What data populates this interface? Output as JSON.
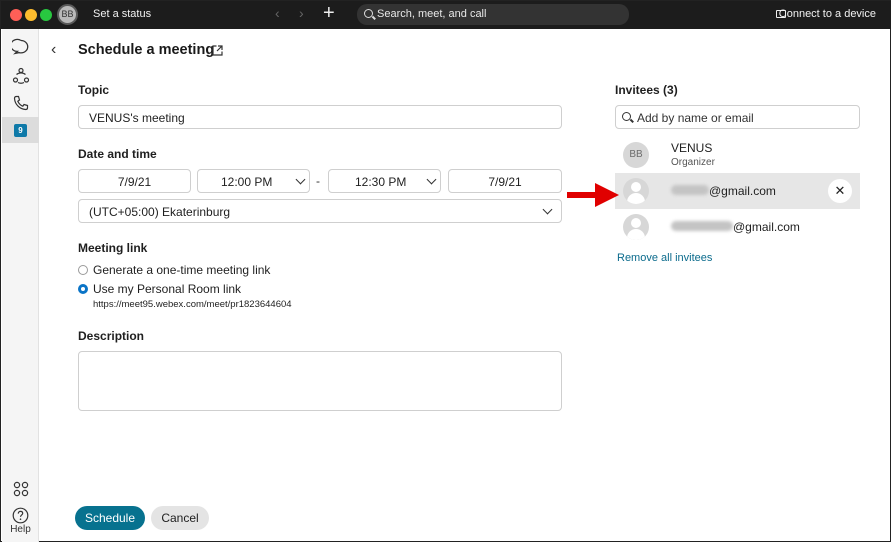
{
  "titlebar": {
    "avatar_initials": "BB",
    "status_label": "Set a status",
    "search_placeholder": "Search, meet, and call",
    "connect_label": "Connect to a device"
  },
  "rail": {
    "items": [
      {
        "icon": "chat-bubble-icon"
      },
      {
        "icon": "teams-icon"
      },
      {
        "icon": "phone-icon"
      },
      {
        "icon": "calendar-icon",
        "badge": "9"
      }
    ],
    "apps_icon": "apps-grid-icon",
    "help_label": "Help"
  },
  "page": {
    "title": "Schedule a meeting"
  },
  "form": {
    "topic_label": "Topic",
    "topic_value": "VENUS's meeting",
    "datetime_label": "Date and time",
    "start_date": "7/9/21",
    "start_time": "12:00 PM",
    "separator": "-",
    "end_time": "12:30 PM",
    "end_date": "7/9/21",
    "timezone": "(UTC+05:00) Ekaterinburg",
    "meeting_link_label": "Meeting link",
    "option_onetime": "Generate a one-time meeting link",
    "option_personal": "Use my Personal Room link",
    "selected_option": "Use my Personal Room link",
    "personal_room_url": "https://meet95.webex.com/meet/pr1823644604",
    "description_label": "Description",
    "description_value": ""
  },
  "actions": {
    "schedule_label": "Schedule",
    "cancel_label": "Cancel"
  },
  "invitees": {
    "title": "Invitees (3)",
    "search_placeholder": "Add by name or email",
    "list": [
      {
        "initials": "BB",
        "name": "VENUS",
        "role": "Organizer"
      },
      {
        "email_suffix": "@gmail.com",
        "highlighted": true
      },
      {
        "email_suffix": "@gmail.com"
      }
    ],
    "remove_all_label": "Remove all invitees"
  },
  "colors": {
    "primary": "#07728f",
    "link": "#0b6b8c",
    "radio_selected": "#0a74c7",
    "annotation_arrow": "#e00000"
  }
}
